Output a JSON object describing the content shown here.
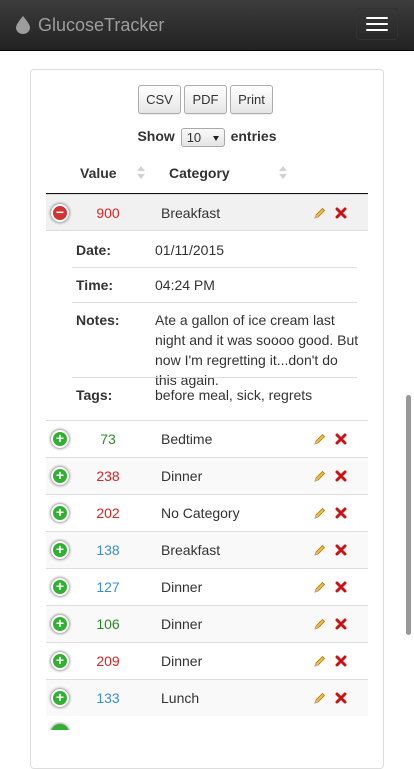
{
  "app": {
    "brand": "GlucoseTracker"
  },
  "toolbar": {
    "csv": "CSV",
    "pdf": "PDF",
    "print": "Print"
  },
  "length": {
    "show": "Show",
    "value": "10",
    "entries": "entries"
  },
  "table": {
    "headers": {
      "value": "Value",
      "category": "Category"
    },
    "expanded": {
      "value": "900",
      "category": "Breakfast",
      "color": "#dd2222",
      "date_label": "Date:",
      "date": "01/11/2015",
      "time_label": "Time:",
      "time": "04:24 PM",
      "notes_label": "Notes:",
      "notes": "Ate a gallon of ice cream last night and it was soooo good. But now I'm regretting it...don't do this again.",
      "tags_label": "Tags:",
      "tags": "before meal, sick, regrets"
    },
    "rows": [
      {
        "value": "73",
        "category": "Bedtime",
        "color": "#2a8a2a"
      },
      {
        "value": "238",
        "category": "Dinner",
        "color": "#dd2222"
      },
      {
        "value": "202",
        "category": "No Category",
        "color": "#dd2222"
      },
      {
        "value": "138",
        "category": "Breakfast",
        "color": "#3a8fd0"
      },
      {
        "value": "127",
        "category": "Dinner",
        "color": "#3a8fd0"
      },
      {
        "value": "106",
        "category": "Dinner",
        "color": "#2a8a2a"
      },
      {
        "value": "209",
        "category": "Dinner",
        "color": "#dd2222"
      },
      {
        "value": "133",
        "category": "Lunch",
        "color": "#3a8fd0"
      }
    ]
  },
  "icons": {
    "brand": "drop-icon",
    "menu": "hamburger-icon",
    "edit": "pencil-icon",
    "delete": "x-icon"
  }
}
